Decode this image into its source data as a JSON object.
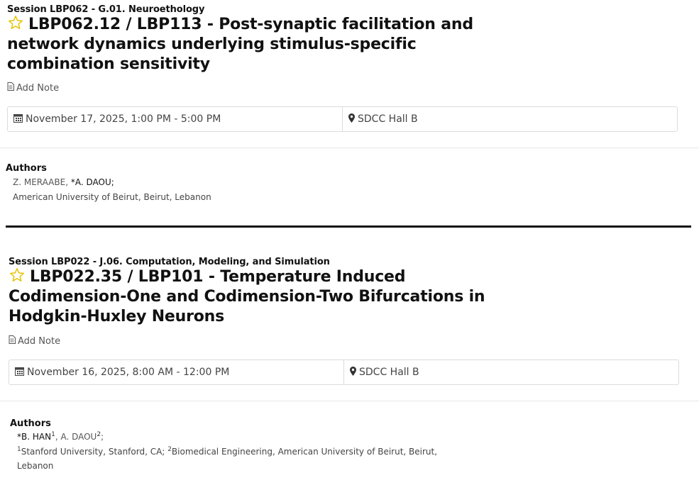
{
  "entries": [
    {
      "session": "Session LBP062 - G.01. Neuroethology",
      "title": "LBP062.12 / LBP113 - Post-synaptic facilitation and network dynamics underlying stimulus-specific combination sensitivity",
      "add_note": "Add Note",
      "datetime": "November 17, 2025, 1:00 PM - 5:00 PM",
      "location": "SDCC Hall B",
      "authors_heading": "Authors",
      "authors": [
        {
          "name": "Z. MERAABE,",
          "sup": ""
        },
        {
          "name": "*A. DAOU;",
          "sup": ""
        }
      ],
      "affiliation": "American University of Beirut, Beirut, Lebanon"
    },
    {
      "session": "Session LBP022 - J.06. Computation, Modeling, and Simulation",
      "title": "LBP022.35 / LBP101 - Temperature Induced Codimension-One and Codimension-Two Bifurcations in Hodgkin-Huxley Neurons",
      "add_note": "Add Note",
      "datetime": "November 16, 2025, 8:00 AM - 12:00 PM",
      "location": "SDCC Hall B",
      "authors_heading": "Authors",
      "authors": [
        {
          "name": "*B. HAN",
          "sup": "1"
        },
        {
          "name": "A. DAOU",
          "sup": "2"
        }
      ],
      "affiliations": [
        {
          "sup": "1",
          "text": "Stanford University, Stanford, CA;"
        },
        {
          "sup": "2",
          "text": "Biomedical Engineering, American University of Beirut, Beirut, Lebanon"
        }
      ]
    }
  ],
  "colors": {
    "star": "#e6c200",
    "separator": "#111111",
    "border": "#dcdcdc"
  },
  "icons": [
    "star-icon",
    "note-icon",
    "calendar-icon",
    "map-marker-icon"
  ]
}
